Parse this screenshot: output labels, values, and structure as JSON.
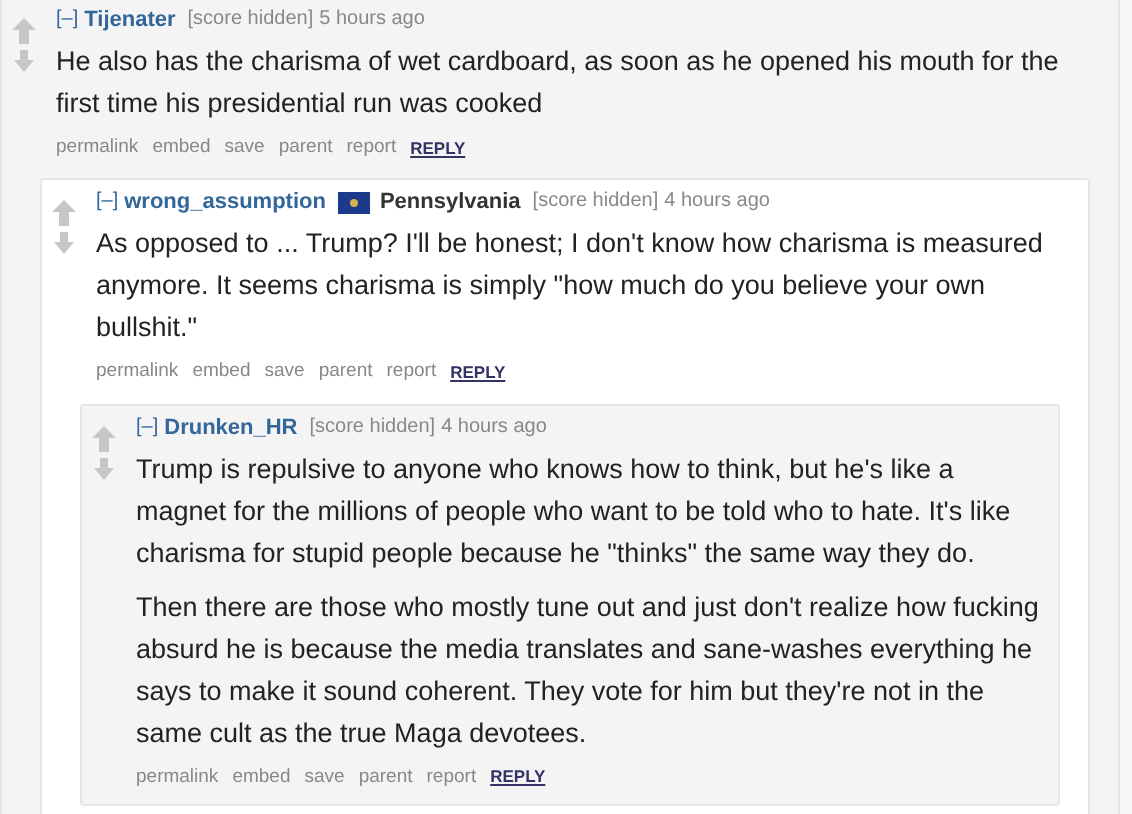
{
  "comments": [
    {
      "collapse": "[–]",
      "author": "Tijenater",
      "score": "[score hidden]",
      "time": "5 hours ago",
      "paragraphs": [
        "He also has the charisma of wet cardboard, as soon as he opened his mouth for the first time his presidential run was cooked"
      ],
      "actions": [
        "permalink",
        "embed",
        "save",
        "parent",
        "report",
        "REPLY"
      ],
      "children": [
        {
          "collapse": "[–]",
          "author": "wrong_assumption",
          "flair": "Pennsylvania",
          "score": "[score hidden]",
          "time": "4 hours ago",
          "paragraphs": [
            "As opposed to ... Trump? I'll be honest; I don't know how charisma is measured anymore. It seems charisma is simply \"how much do you believe your own bullshit.\""
          ],
          "actions": [
            "permalink",
            "embed",
            "save",
            "parent",
            "report",
            "REPLY"
          ],
          "children": [
            {
              "collapse": "[–]",
              "author": "Drunken_HR",
              "score": "[score hidden]",
              "time": "4 hours ago",
              "paragraphs": [
                "Trump is repulsive to anyone who knows how to think, but he's like a magnet for the millions of people who want to be told who to hate. It's like charisma for stupid people because he \"thinks\" the same way they do.",
                "Then there are those who mostly tune out and just don't realize how fucking absurd he is because the media translates and sane-washes everything he says to make it sound coherent. They vote for him but they're not in the same cult as the true Maga devotees."
              ],
              "actions": [
                "permalink",
                "embed",
                "save",
                "parent",
                "report",
                "REPLY"
              ]
            }
          ]
        }
      ]
    }
  ]
}
